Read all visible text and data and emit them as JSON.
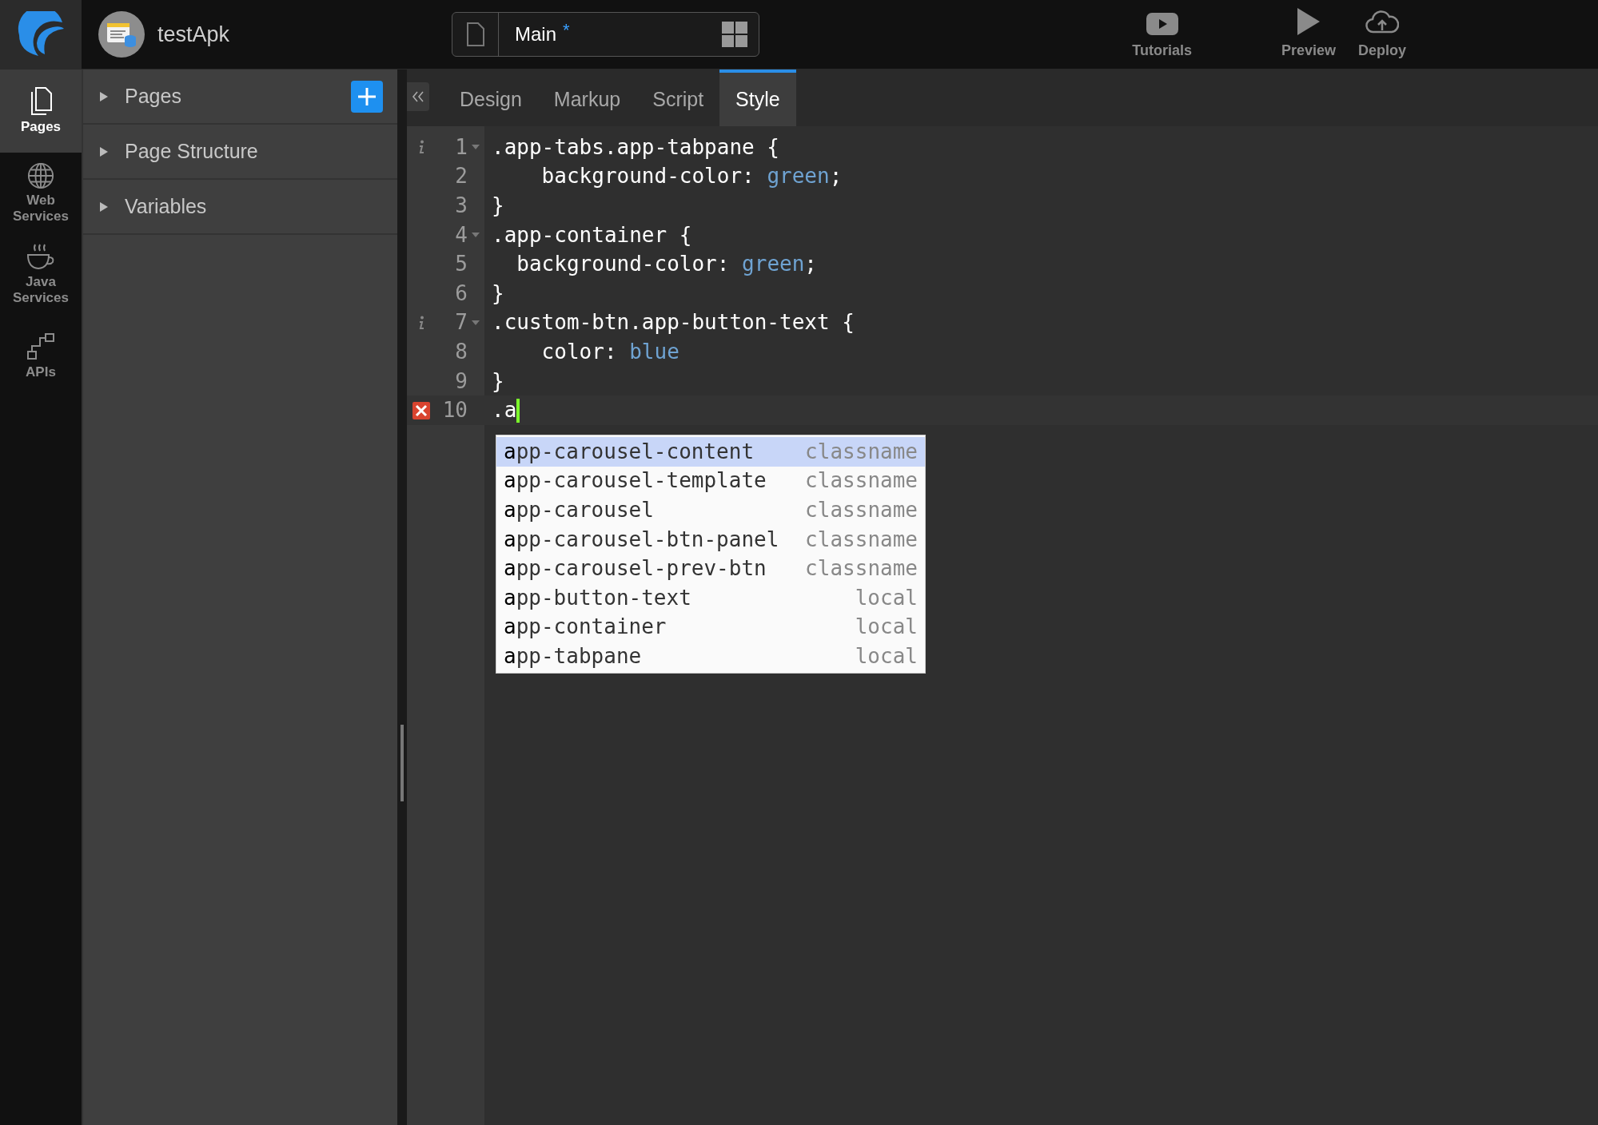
{
  "app": {
    "name": "testApk"
  },
  "file_tab": {
    "title": "Main",
    "modified_mark": "*"
  },
  "toolbar": [
    {
      "label": "Tutorials",
      "kind": "video"
    },
    {
      "label": "Preview",
      "kind": "play"
    },
    {
      "label": "Deploy",
      "kind": "cloud"
    }
  ],
  "rail": [
    {
      "label": "Pages",
      "kind": "pages",
      "selected": true
    },
    {
      "label": "Web Services",
      "kind": "globe",
      "selected": false
    },
    {
      "label": "Java Services",
      "kind": "cup",
      "selected": false
    },
    {
      "label": "APIs",
      "kind": "api",
      "selected": false
    }
  ],
  "panel": {
    "sections": [
      {
        "title": "Pages",
        "expanded": false,
        "add_button": true
      },
      {
        "title": "Page Structure",
        "expanded": false,
        "add_button": false
      },
      {
        "title": "Variables",
        "expanded": false,
        "add_button": false
      }
    ]
  },
  "tabs": [
    {
      "label": "Design",
      "selected": false
    },
    {
      "label": "Markup",
      "selected": false
    },
    {
      "label": "Script",
      "selected": false
    },
    {
      "label": "Style",
      "selected": true
    }
  ],
  "editor": {
    "lines": [
      {
        "number": "1",
        "fold": true,
        "info": true,
        "error": false,
        "code": ".app-tabs.app-tabpane {"
      },
      {
        "number": "2",
        "fold": false,
        "info": false,
        "error": false,
        "code": "    background-color: ",
        "value": "green",
        "end": ";"
      },
      {
        "number": "3",
        "fold": false,
        "info": false,
        "error": false,
        "code": "}"
      },
      {
        "number": "4",
        "fold": true,
        "info": false,
        "error": false,
        "code": ".app-container {"
      },
      {
        "number": "5",
        "fold": false,
        "info": false,
        "error": false,
        "code": "  background-color: ",
        "value": "green",
        "end": ";"
      },
      {
        "number": "6",
        "fold": false,
        "info": false,
        "error": false,
        "code": "}"
      },
      {
        "number": "7",
        "fold": true,
        "info": true,
        "error": false,
        "code": ".custom-btn.app-button-text {"
      },
      {
        "number": "8",
        "fold": false,
        "info": false,
        "error": false,
        "code": "    color: ",
        "value": "blue"
      },
      {
        "number": "9",
        "fold": false,
        "info": false,
        "error": false,
        "code": "}"
      },
      {
        "number": "10",
        "fold": false,
        "info": false,
        "error": true,
        "code": ".a",
        "cursor": true
      }
    ],
    "completions": [
      {
        "match": "a",
        "rest": "pp-carousel-content",
        "hint": "classname",
        "selected": true
      },
      {
        "match": "a",
        "rest": "pp-carousel-template",
        "hint": "classname",
        "selected": false
      },
      {
        "match": "a",
        "rest": "pp-carousel",
        "hint": "classname",
        "selected": false
      },
      {
        "match": "a",
        "rest": "pp-carousel-btn-panel",
        "hint": "classname",
        "selected": false
      },
      {
        "match": "a",
        "rest": "pp-carousel-prev-btn",
        "hint": "classname",
        "selected": false
      },
      {
        "match": "a",
        "rest": "pp-button-text",
        "hint": "local",
        "selected": false
      },
      {
        "match": "a",
        "rest": "pp-container",
        "hint": "local",
        "selected": false
      },
      {
        "match": "a",
        "rest": "pp-tabpane",
        "hint": "local",
        "selected": false
      }
    ]
  }
}
